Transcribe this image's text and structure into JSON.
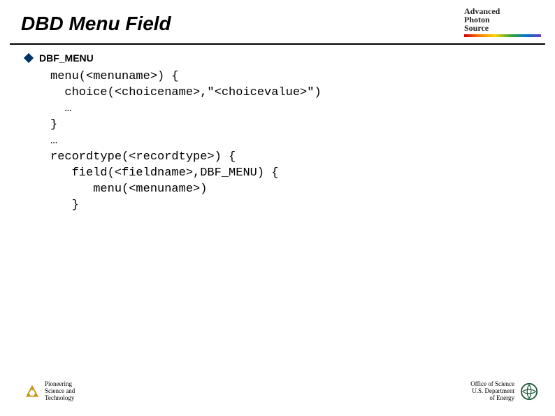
{
  "slide": {
    "title": "DBD Menu Field"
  },
  "logo": {
    "line1": "Advanced",
    "line2": "Photon",
    "line3": "Source"
  },
  "bullet": {
    "label": "DBF_MENU"
  },
  "code": {
    "l1": "menu(<menuname>) {",
    "l2": "  choice(<choicename>,\"<choicevalue>\")",
    "l3": "  …",
    "l4": "}",
    "l5": "…",
    "l6": "recordtype(<recordtype>) {",
    "l7": "   field(<fieldname>,DBF_MENU) {",
    "l8": "      menu(<menuname>)",
    "l9": "   }"
  },
  "footer": {
    "left": {
      "line1": "Pioneering",
      "line2": "Science and",
      "line3": "Technology"
    },
    "right": {
      "line1": "Office of Science",
      "line2": "U.S. Department",
      "line3": "of Energy"
    }
  }
}
